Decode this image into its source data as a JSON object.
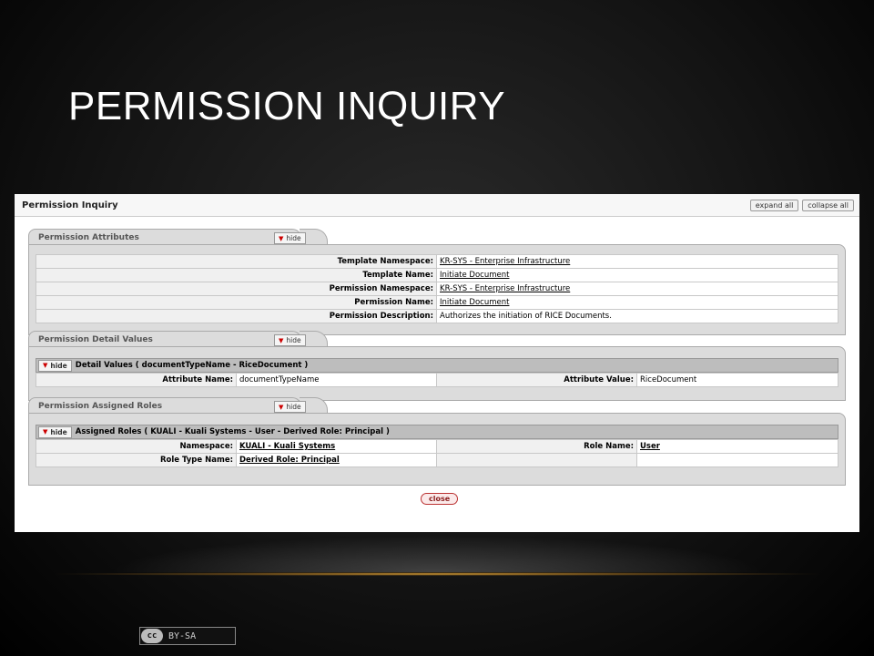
{
  "slide": {
    "title": "PERMISSION INQUIRY",
    "license": "BY-SA",
    "license_mark": "cc"
  },
  "app": {
    "title": "Permission Inquiry",
    "expand_all": "expand all",
    "collapse_all": "collapse all",
    "hide_label": "hide",
    "close_label": "close"
  },
  "attributes": {
    "title": "Permission Attributes",
    "rows": [
      {
        "label": "Template Namespace:",
        "value": "KR-SYS - Enterprise Infrastructure"
      },
      {
        "label": "Template Name:",
        "value": "Initiate Document"
      },
      {
        "label": "Permission Namespace:",
        "value": "KR-SYS - Enterprise Infrastructure"
      },
      {
        "label": "Permission Name:",
        "value": "Initiate Document"
      },
      {
        "label": "Permission Description:",
        "value": "Authorizes the initiation of RICE Documents."
      }
    ]
  },
  "detail": {
    "title": "Permission Detail Values",
    "sub_title": "Detail Values ( documentTypeName - RiceDocument )",
    "attr_name_label": "Attribute Name:",
    "attr_name_value": "documentTypeName",
    "attr_value_label": "Attribute Value:",
    "attr_value_value": "RiceDocument"
  },
  "roles": {
    "title": "Permission Assigned Roles",
    "sub_title": "Assigned Roles ( KUALI - Kuali Systems - User - Derived Role: Principal )",
    "namespace_label": "Namespace:",
    "namespace_value": "KUALI - Kuali Systems",
    "role_name_label": "Role Name:",
    "role_name_value": "User",
    "role_type_label": "Role Type Name:",
    "role_type_value": "Derived Role: Principal"
  },
  "colors": {
    "accent_glow": "#d9a13a",
    "close_border": "#b33333"
  }
}
